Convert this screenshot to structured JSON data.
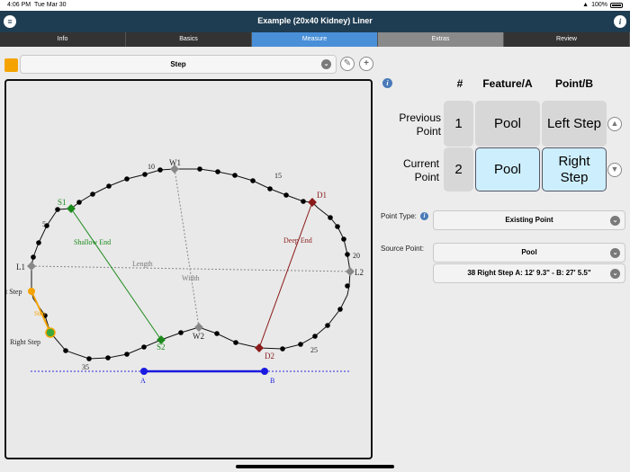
{
  "status": {
    "time": "4:06 PM",
    "date": "Tue Mar 30",
    "battery": "100%"
  },
  "title": "Example (20x40 Kidney) Liner",
  "tabs": [
    "Info",
    "Basics",
    "Measure",
    "Extras",
    "Review"
  ],
  "active_tab": "Measure",
  "feature_select": {
    "value": "Step"
  },
  "table": {
    "headers": {
      "num": "#",
      "a": "Feature/A",
      "b": "Point/B"
    },
    "previous": {
      "label1": "Previous",
      "label2": "Point",
      "num": "1",
      "a": "Pool",
      "b": "Left Step"
    },
    "current": {
      "label1": "Current",
      "label2": "Point",
      "num": "2",
      "a": "Pool",
      "b1": "Right",
      "b2": "Step"
    }
  },
  "point_type": {
    "label": "Point Type:",
    "value": "Existing Point"
  },
  "source_point": {
    "label": "Source Point:",
    "value": "Pool",
    "detail": "38 Right Step A: 12' 9.3\" - B: 27' 5.5\""
  },
  "drawing": {
    "numbers": [
      "5",
      "10",
      "15",
      "20",
      "25",
      "35"
    ],
    "points": {
      "W1": "W1",
      "W2": "W2",
      "D1": "D1",
      "D2": "D2",
      "S1": "S1",
      "S2": "S2",
      "L1": "L1",
      "L2": "L2",
      "A": "A",
      "B": "B"
    },
    "lines": {
      "shallow": "Shallow End",
      "deep": "Deep End",
      "length": "Length",
      "width": "Width"
    },
    "step_left": "t Step",
    "step_label": "Step",
    "right_step": "Right Step"
  },
  "colors": {
    "nav": "#1f3d52",
    "tab_active": "#4a90d9",
    "accent_orange": "#f5a300",
    "shallow": "#1b8a1b",
    "deep": "#8b1a1a",
    "ab_line": "#1a1ae0"
  }
}
